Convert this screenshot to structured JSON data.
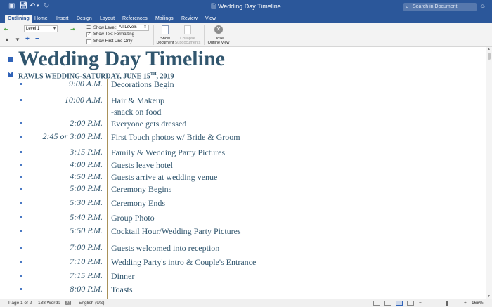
{
  "app": {
    "title": "Wedding Day Timeline",
    "doc_icon": "word-doc-icon"
  },
  "toolbar": {
    "search_placeholder": "Search in Document",
    "smiley": "☺"
  },
  "tabs": [
    {
      "label": "Outlining",
      "active": true
    },
    {
      "label": "Home"
    },
    {
      "label": "Insert"
    },
    {
      "label": "Design"
    },
    {
      "label": "Layout"
    },
    {
      "label": "References"
    },
    {
      "label": "Mailings"
    },
    {
      "label": "Review"
    },
    {
      "label": "View"
    }
  ],
  "ribbon": {
    "level_value": "Level 1",
    "show_level_label": "Show Level:",
    "show_level_value": "All Levels",
    "show_text_formatting_label": "Show Text Formatting",
    "show_text_formatting_checked": true,
    "show_first_line_label": "Show First Line Only",
    "show_first_line_checked": false,
    "show_document_label_1": "Show",
    "show_document_label_2": "Document",
    "collapse_subdocs_label_1": "Collapse",
    "collapse_subdocs_label_2": "Subdocuments",
    "close_outline_label_1": "Close",
    "close_outline_label_2": "Outline View"
  },
  "document": {
    "heading": "Wedding Day Timeline",
    "subheading_main": "RAWLS WEDDING-SATURDAY, JUNE 15",
    "subheading_sup": "TH",
    "subheading_end": ", 2019",
    "schedule": [
      {
        "time": "9:00 A.M.",
        "events": [
          "Decorations Begin"
        ]
      },
      {
        "time": "10:00 A.M.",
        "events": [
          "Hair & Makeup",
          "-snack on food"
        ]
      },
      {
        "time": "2:00 P.M.",
        "events": [
          "Everyone gets dressed"
        ]
      },
      {
        "time": "2:45 or 3:00 P.M.",
        "events": [
          "First Touch photos w/ Bride & Groom"
        ]
      },
      {
        "time": "3:15 P.M.",
        "events": [
          "Family & Wedding Party Pictures"
        ]
      },
      {
        "time": "4:00 P.M.",
        "events": [
          "Guests leave hotel"
        ]
      },
      {
        "time": "4:50 P.M.",
        "events": [
          "Guests arrive at wedding venue"
        ]
      },
      {
        "time": "5:00 P.M.",
        "events": [
          "Ceremony Begins"
        ]
      },
      {
        "time": "5:30 P.M.",
        "events": [
          "Ceremony Ends"
        ]
      },
      {
        "time": "5:40 P.M.",
        "events": [
          "Group Photo"
        ]
      },
      {
        "time": "5:50 P.M.",
        "events": [
          "Cocktail Hour/Wedding Party Pictures"
        ]
      },
      {
        "time": "7:00 P.M.",
        "events": [
          "Guests welcomed into reception"
        ]
      },
      {
        "time": "7:10 P.M.",
        "events": [
          "Wedding Party's intro & Couple's Entrance"
        ]
      },
      {
        "time": "7:15 P.M.",
        "events": [
          "Dinner"
        ]
      },
      {
        "time": "8:00 P.M.",
        "events": [
          "Toasts"
        ]
      }
    ]
  },
  "status": {
    "page": "Page 1 of 2",
    "words": "138 Words",
    "language": "English (US)",
    "zoom": "168%",
    "zoom_minus": "−",
    "zoom_plus": "+"
  },
  "colors": {
    "ribbon_blue": "#2b579a",
    "heading_color": "#31566e",
    "timeline_line": "#a9915a"
  }
}
